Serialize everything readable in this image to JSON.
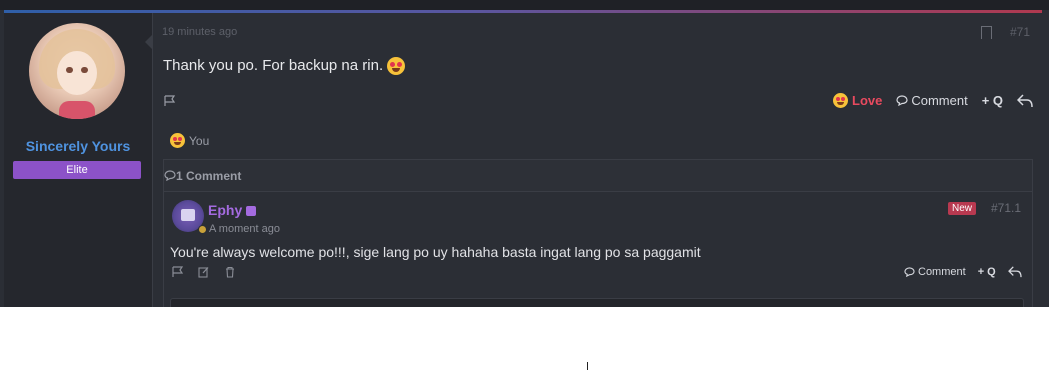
{
  "user": {
    "name": "Sincerely Yours",
    "rank": "Elite"
  },
  "post": {
    "time": "19 minutes ago",
    "number": "#71",
    "message": "Thank you po. For backup na rin.",
    "actions": {
      "love": "Love",
      "comment": "Comment",
      "quote": "+ Q"
    },
    "reactions_by": "You"
  },
  "comments": {
    "header": "1 Comment",
    "items": [
      {
        "author": "Ephy",
        "time": "A moment ago",
        "badge": "New",
        "number": "#71.1",
        "text": "You're always welcome po!!!, sige lang po uy hahaha basta ingat lang po sa paggamit",
        "actions": {
          "comment": "Comment",
          "quote": "+ Q"
        }
      }
    ]
  },
  "colors": {
    "accent_blue": "#4f93e0",
    "love_red": "#e84a5f",
    "rank_purple": "#8c52c8",
    "commenter_purple": "#a46be0"
  }
}
